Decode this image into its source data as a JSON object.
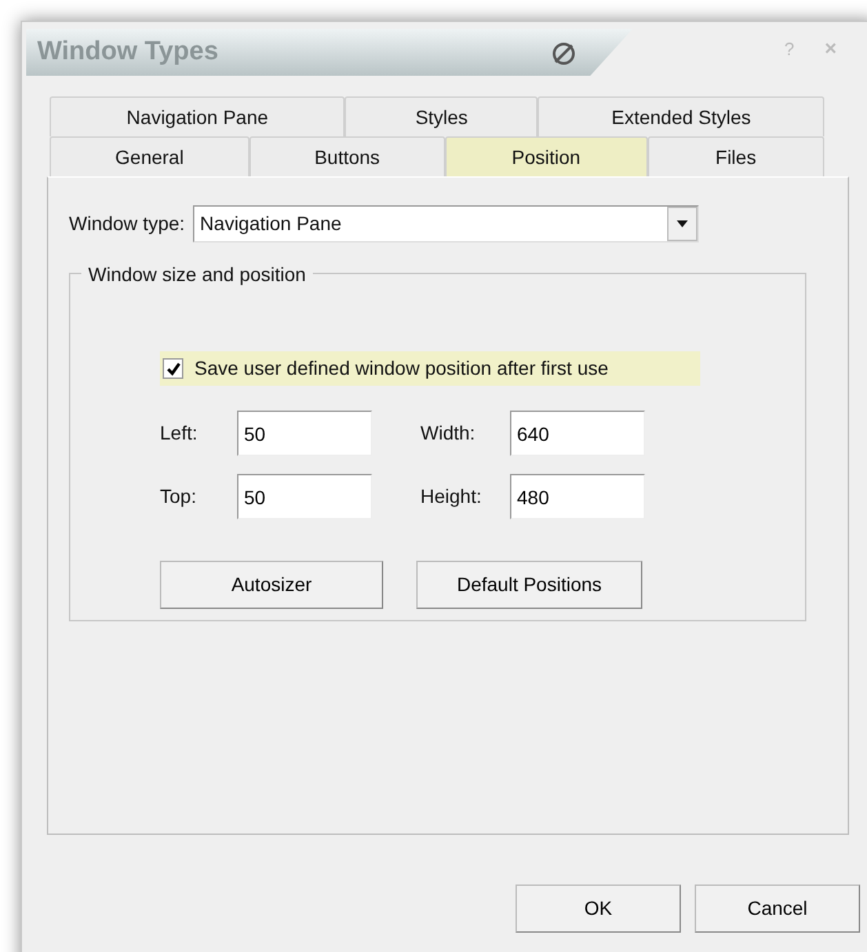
{
  "window": {
    "title": "Window Types",
    "title_buttons": [
      "?",
      "×"
    ]
  },
  "tab_rows": [
    [
      {
        "label": "Navigation Pane",
        "selected": false
      },
      {
        "label": "Styles",
        "selected": false
      },
      {
        "label": "Extended Styles",
        "selected": false
      }
    ],
    [
      {
        "label": "General",
        "selected": false
      },
      {
        "label": "Buttons",
        "selected": false
      },
      {
        "label": "Position",
        "selected": true
      },
      {
        "label": "Files",
        "selected": false
      }
    ]
  ],
  "window_type": {
    "label": "Window type:",
    "value": "Navigation Pane"
  },
  "group": {
    "title": "Window size and position",
    "checkbox": {
      "label": "Save user defined window position after first use",
      "checked": true
    },
    "fields": [
      {
        "label": "Left:",
        "value": "50"
      },
      {
        "label": "Width:",
        "value": "640"
      },
      {
        "label": "Top:",
        "value": "50"
      },
      {
        "label": "Height:",
        "value": "480"
      }
    ],
    "buttons": [
      "Autosizer",
      "Default Positions"
    ]
  },
  "buttons": [
    "OK",
    "Cancel"
  ]
}
